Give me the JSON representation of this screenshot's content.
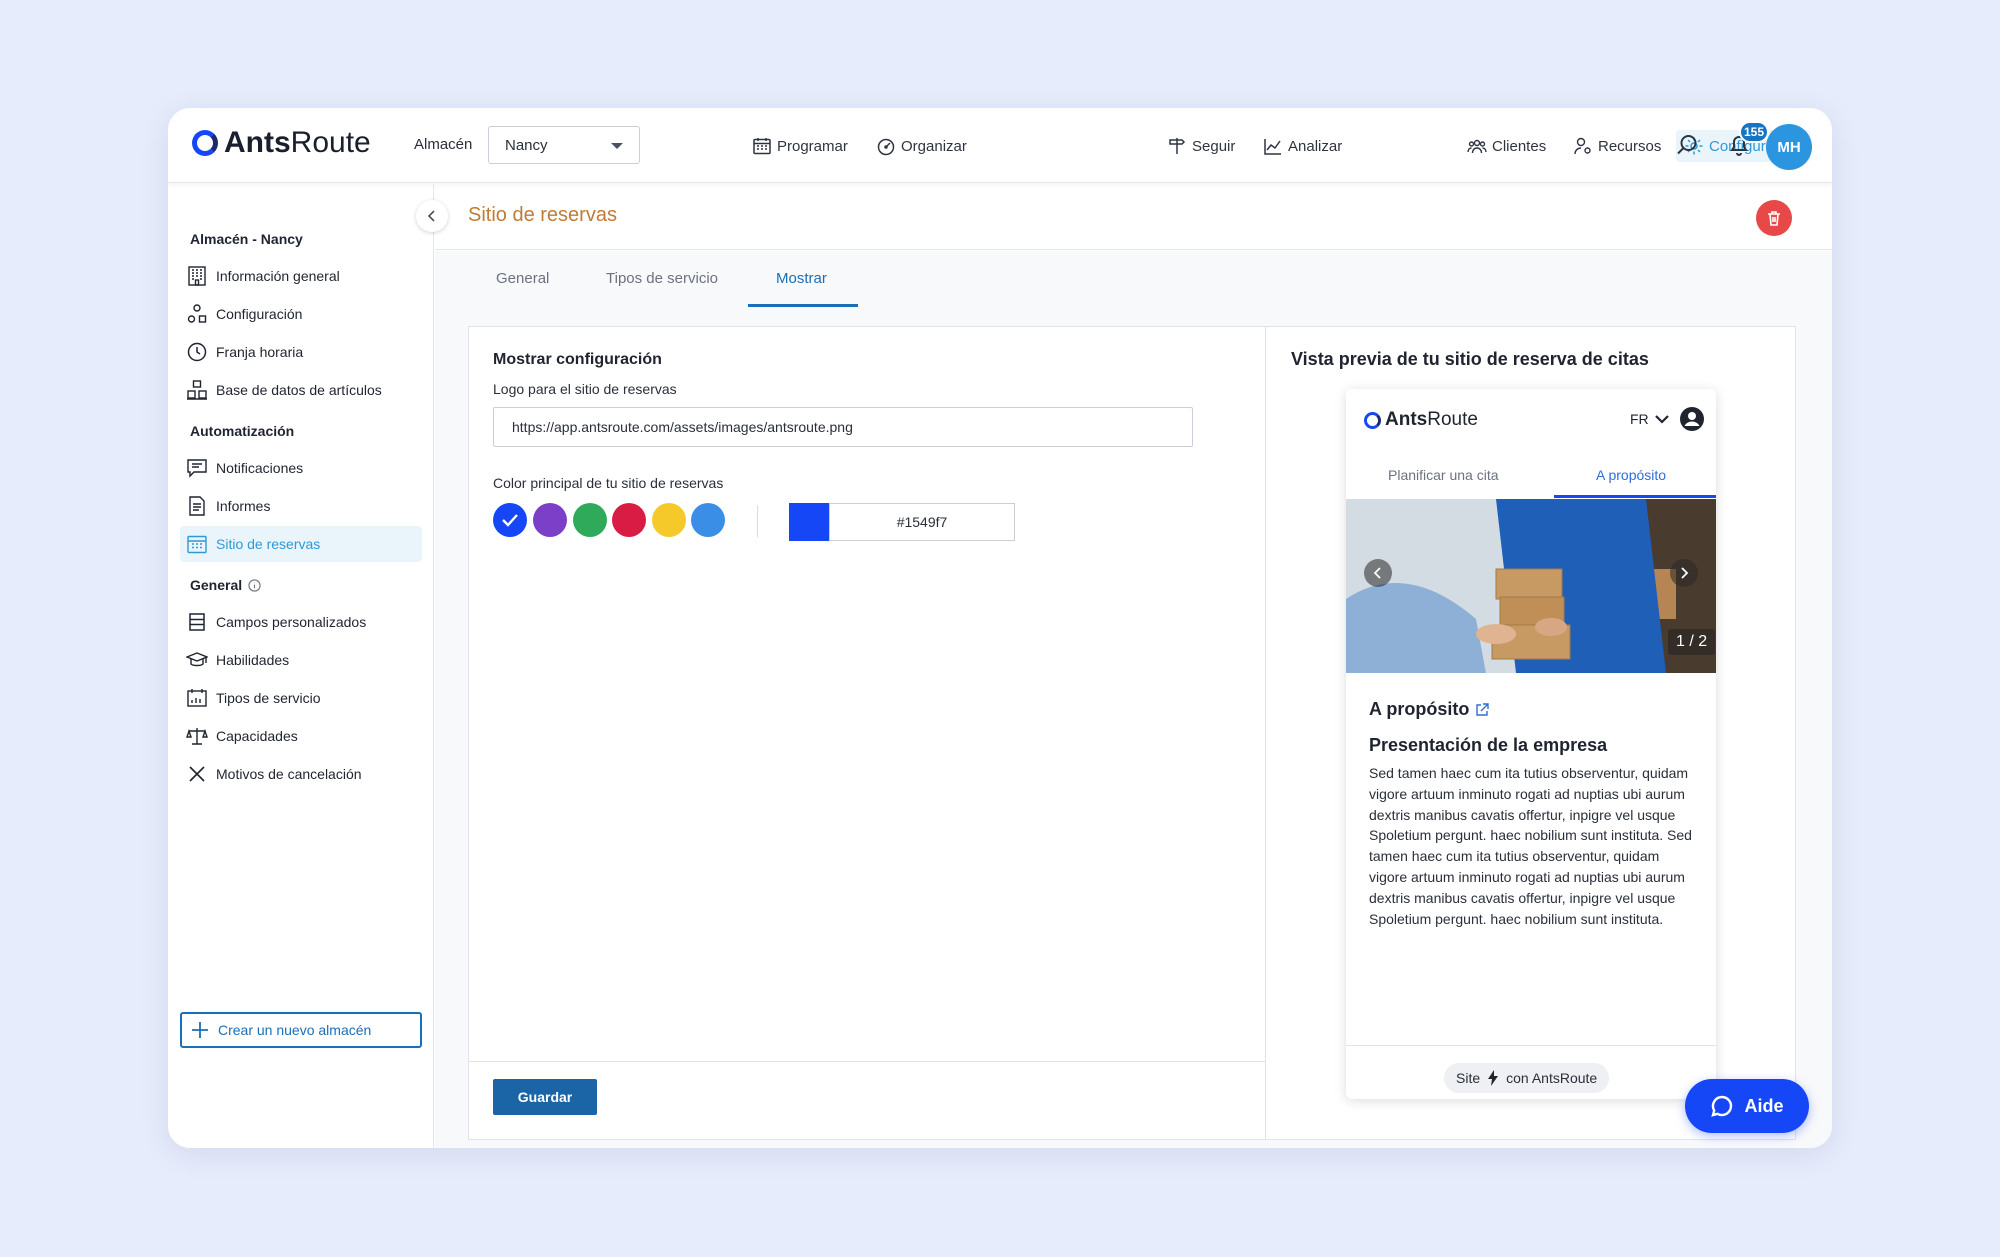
{
  "header": {
    "logo_bold": "Ants",
    "logo_rest": "Route",
    "warehouse_label": "Almacén",
    "warehouse_value": "Nancy",
    "nav": [
      "Programar",
      "Organizar",
      "Seguir",
      "Analizar"
    ],
    "right_nav": [
      "Clientes",
      "Recursos",
      "Configuración"
    ],
    "notifications_count": "155",
    "avatar_initials": "MH"
  },
  "sidebar": {
    "section1_title": "Almacén - Nancy",
    "section1_items": [
      "Información general",
      "Configuración",
      "Franja horaria",
      "Base de datos de artículos"
    ],
    "section2_title": "Automatización",
    "section2_items": [
      "Notificaciones",
      "Informes",
      "Sitio de reservas"
    ],
    "section3_title": "General",
    "section3_items": [
      "Campos personalizados",
      "Habilidades",
      "Tipos de servicio",
      "Capacidades",
      "Motivos de cancelación"
    ],
    "new_warehouse": "Crear un nuevo almacén",
    "active_item": "Sitio de reservas"
  },
  "page": {
    "title": "Sitio de reservas",
    "tabs": [
      "General",
      "Tipos de servicio",
      "Mostrar"
    ],
    "active_tab": "Mostrar"
  },
  "config": {
    "title": "Mostrar configuración",
    "logo_label": "Logo para el sitio de reservas",
    "logo_url": "https://app.antsroute.com/assets/images/antsroute.png",
    "color_label": "Color principal de tu sitio de reservas",
    "swatches": [
      "#1547f7",
      "#7b3fc8",
      "#2eaa5a",
      "#d91c44",
      "#f5c92a",
      "#3a8ee6"
    ],
    "selected_color": "#1547f7",
    "hex_value": "#1549f7",
    "save_label": "Guardar"
  },
  "preview": {
    "title": "Vista previa de tu sitio de reserva de citas",
    "logo_bold": "Ants",
    "logo_rest": "Route",
    "lang": "FR",
    "tabs": [
      "Planificar una cita",
      "A propósito"
    ],
    "pager": "1 / 2",
    "heading": "A propósito",
    "subheading": "Presentación de la empresa",
    "body": "Sed tamen haec cum ita tutius observentur, quidam vigore artuum inminuto rogati ad nuptias ubi aurum dextris manibus cavatis offertur, inpigre vel usque Spoletium pergunt. haec nobilium sunt instituta. Sed tamen haec cum ita tutius observentur, quidam vigore artuum inminuto rogati ad nuptias ubi aurum dextris manibus cavatis offertur, inpigre vel usque Spoletium pergunt. haec nobilium sunt instituta.",
    "footer_site": "Site",
    "footer_with": "con AntsRoute"
  },
  "help": {
    "label": "Aide"
  }
}
